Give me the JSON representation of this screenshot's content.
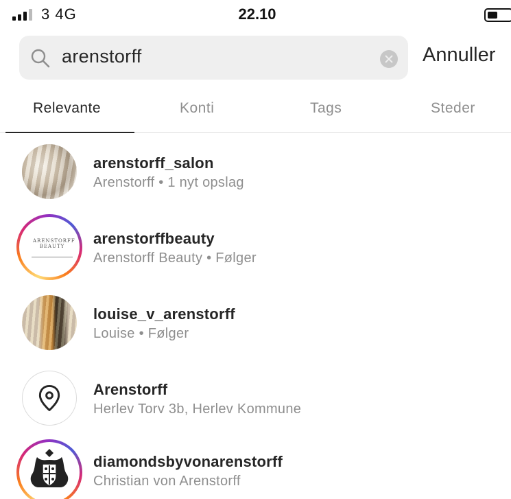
{
  "status_bar": {
    "carrier": "3  4G",
    "time": "22.10"
  },
  "search": {
    "query": "arenstorff",
    "cancel_label": "Annuller"
  },
  "tabs": [
    {
      "label": "Relevante",
      "active": true
    },
    {
      "label": "Konti",
      "active": false
    },
    {
      "label": "Tags",
      "active": false
    },
    {
      "label": "Steder",
      "active": false
    }
  ],
  "results": [
    {
      "title": "arenstorff_salon",
      "subtitle": "Arenstorff • 1 nyt opslag",
      "avatar": "hair-photo",
      "story_ring": false
    },
    {
      "title": "arenstorffbeauty",
      "subtitle": "Arenstorff Beauty • Følger",
      "avatar": "beauty-logo",
      "story_ring": true,
      "logo_text": "ARENSTORFF BEAUTY"
    },
    {
      "title": "louise_v_arenstorff",
      "subtitle": "Louise • Følger",
      "avatar": "hair-photo-gold",
      "story_ring": false
    },
    {
      "title": "Arenstorff",
      "subtitle": "Herlev Torv 3b, Herlev Kommune",
      "avatar": "location-pin-icon",
      "story_ring": false
    },
    {
      "title": "diamondsbyvonarenstorff",
      "subtitle": "Christian von Arenstorff",
      "avatar": "coat-of-arms",
      "story_ring": true
    }
  ],
  "colors": {
    "text_primary": "#262626",
    "text_secondary": "#8e8e8e",
    "search_bg": "#efefef",
    "divider": "#dbdbdb"
  }
}
